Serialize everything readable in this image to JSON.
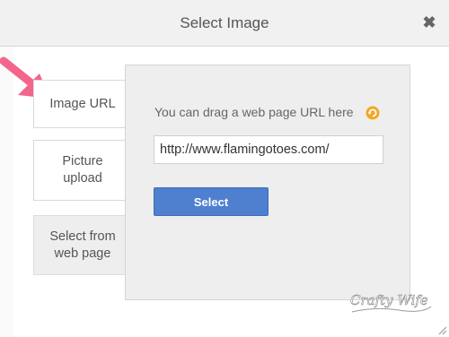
{
  "dialog": {
    "title": "Select Image",
    "close_label": "✖"
  },
  "nav": [
    {
      "label": "Image URL"
    },
    {
      "label": "Picture upload"
    },
    {
      "label": "Select from web page"
    }
  ],
  "panel": {
    "hint": "You can drag a web page URL here",
    "url_value": "http://www.flamingotoes.com/",
    "select_label": "Select"
  },
  "watermark": {
    "text": "Crafty Wife"
  },
  "icons": {
    "annotation_arrow": "pink-arrow-icon",
    "hint_icon": "orange-refresh-icon",
    "resize": "resize-grip-icon"
  },
  "colors": {
    "select_button": "#4f7fcf",
    "arrow": "#f2668b",
    "hint_icon": "#f5a623"
  }
}
